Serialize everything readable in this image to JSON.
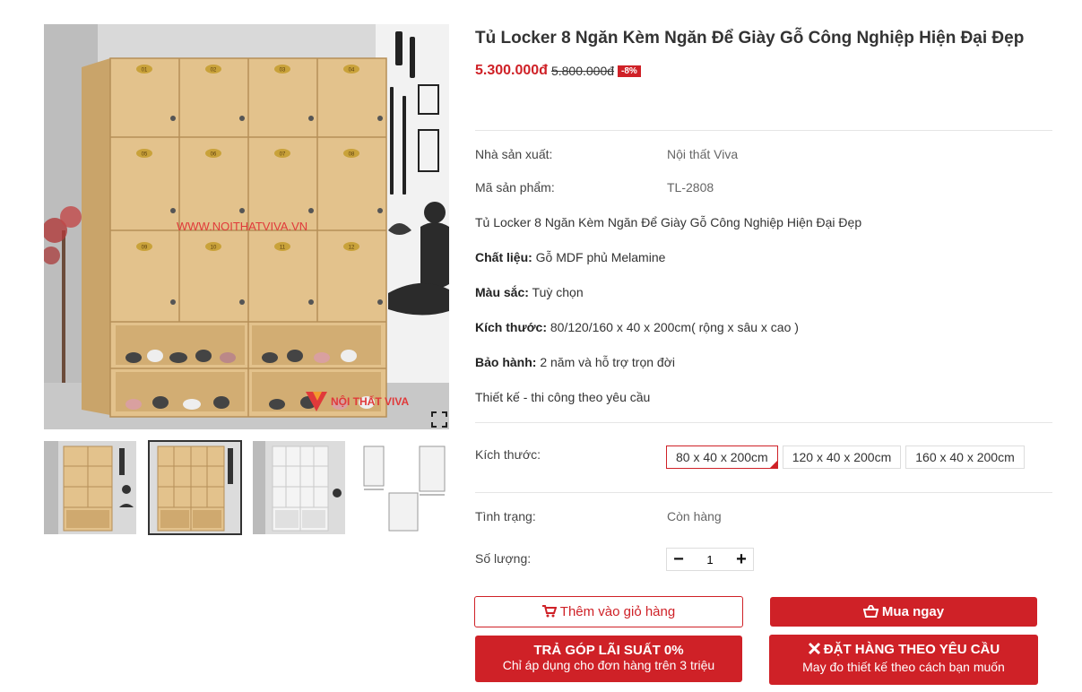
{
  "gallery": {
    "main_alt": "Tủ Locker 8 Ngăn Kèm Ngăn Để Giày Gỗ Công Nghiệp Hiện Đại Đẹp",
    "watermark": "WWW.NOITHATVIVA.VN",
    "brand_logo": "NỘI THẤT VIVA",
    "locker_numbers": [
      "01",
      "02",
      "03",
      "04",
      "05",
      "06",
      "07",
      "08",
      "09",
      "10",
      "11",
      "12"
    ],
    "zoom_icon": "expand-icon",
    "thumbnails": [
      {
        "name": "thumb-wood-locker",
        "active": false
      },
      {
        "name": "thumb-wood-locker-front",
        "active": true
      },
      {
        "name": "thumb-white-locker",
        "active": false
      },
      {
        "name": "thumb-size-diagram",
        "active": false
      }
    ]
  },
  "product": {
    "title": "Tủ Locker 8 Ngăn Kèm Ngăn Để Giày Gỗ Công Nghiệp Hiện Đại Đẹp",
    "price": "5.300.000đ",
    "old_price": "5.800.000đ",
    "discount": "-8%",
    "manufacturer_label": "Nhà sản xuất:",
    "manufacturer": "Nội thất Viva",
    "sku_label": "Mã sản phẩm:",
    "sku": "TL-2808",
    "summary": "Tủ Locker 8 Ngăn Kèm Ngăn Để Giày Gỗ Công Nghiệp Hiện Đại Đẹp",
    "material_label": "Chất liệu:",
    "material": " Gỗ MDF phủ Melamine",
    "color_label": "Màu sắc:",
    "color": " Tuỳ chọn",
    "dimension_label": "Kích thước:",
    "dimension": " 80/120/160 x 40 x 200cm( rộng x sâu x cao )",
    "warranty_label": "Bảo hành:",
    "warranty": " 2 năm và hỗ trợ trọn đời",
    "design_note": "Thiết kế - thi công theo yêu cầu"
  },
  "options": {
    "size_label": "Kích thước:",
    "sizes": [
      "80 x 40 x 200cm",
      "120 x 40 x 200cm",
      "160 x 40 x 200cm"
    ],
    "selected_size": "80 x 40 x 200cm",
    "status_label": "Tình trạng:",
    "status": "Còn hàng",
    "qty_label": "Số lượng:",
    "qty_value": "1",
    "minus": "−",
    "plus": "+"
  },
  "actions": {
    "add_to_cart": "Thêm vào giỏ hàng",
    "buy_now": "Mua ngay",
    "installment_title": "TRẢ GÓP LÃI SUẤT 0%",
    "installment_sub": "Chỉ áp dụng cho đơn hàng trên 3 triệu",
    "custom_order_title": "ĐẶT HÀNG THEO YÊU CẦU",
    "custom_order_sub": "May đo thiết kế theo cách bạn muốn"
  },
  "colors": {
    "accent": "#cf2127",
    "wood": "#e3c28c",
    "wood_dark": "#c9a46a"
  }
}
